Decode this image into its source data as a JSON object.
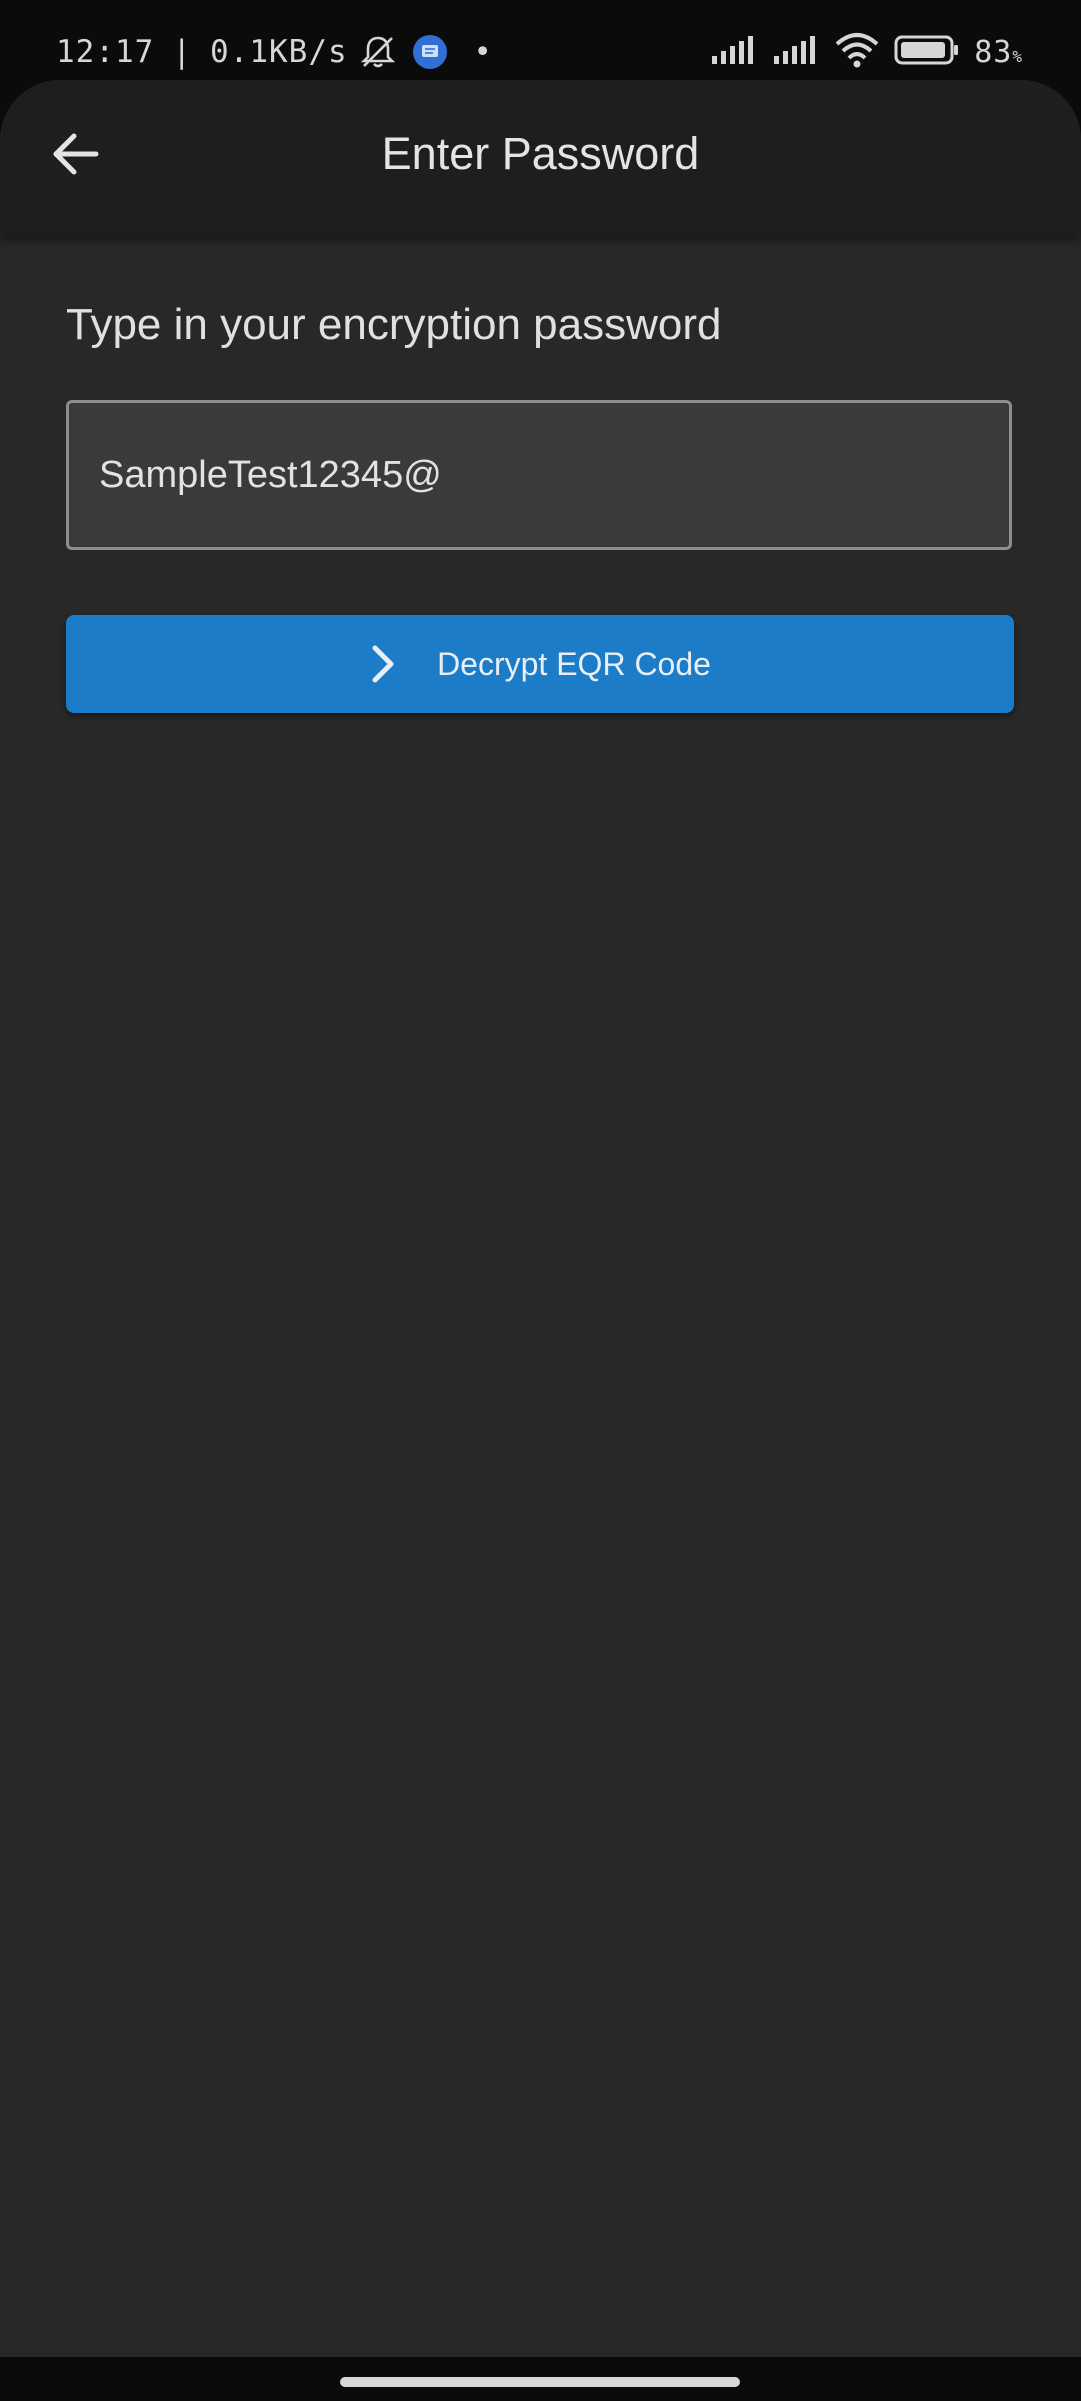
{
  "status_bar": {
    "time": "12:17",
    "separator": "|",
    "net_speed": "0.1KB/s",
    "dot": "•",
    "battery_value": "83",
    "battery_unit": "%",
    "icons": [
      "mute-bell-icon",
      "message-icon",
      "signal-icon",
      "signal-icon",
      "wifi-icon",
      "battery-icon"
    ]
  },
  "app_bar": {
    "title": "Enter Password",
    "back_icon": "arrow-left-icon"
  },
  "form": {
    "prompt": "Type in your encryption password",
    "password_value": "SampleTest12345@",
    "button_label": "Decrypt EQR Code",
    "button_icon": "chevron-right-icon"
  },
  "colors": {
    "app_background": "#282828",
    "app_bar_background": "#1e1e1e",
    "field_background": "#3a3a3a",
    "button_background": "#1d7cc8"
  }
}
